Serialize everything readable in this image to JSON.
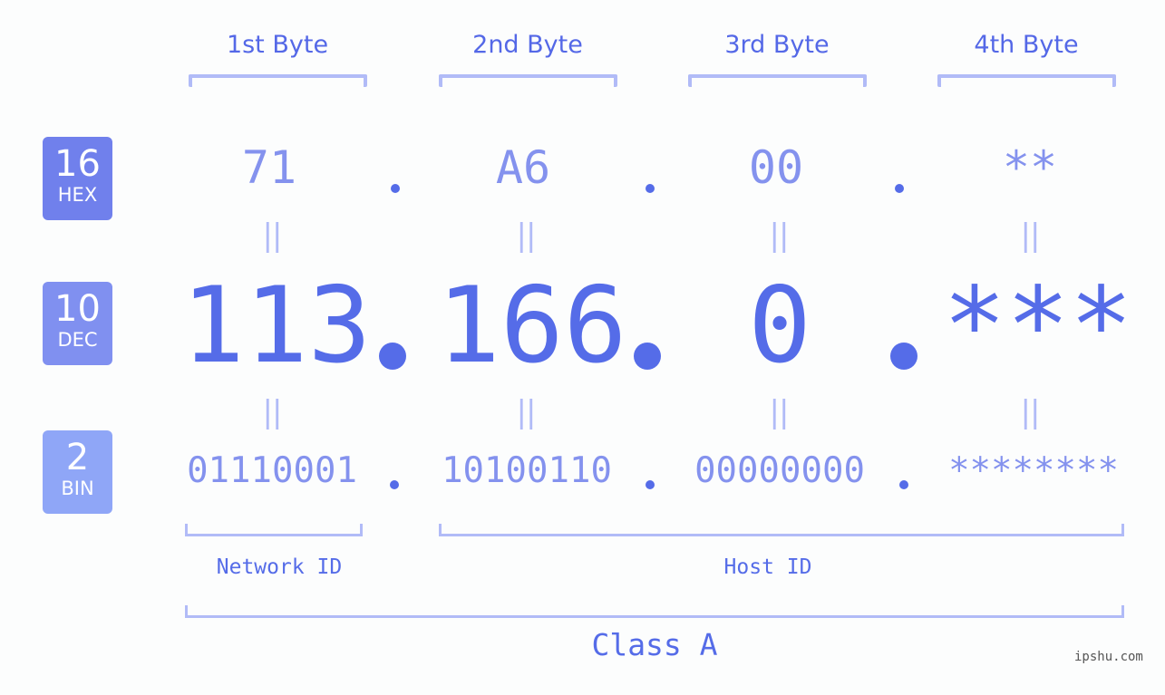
{
  "bytes": [
    {
      "header": "1st Byte",
      "hex": "71",
      "dec": "113",
      "bin": "01110001"
    },
    {
      "header": "2nd Byte",
      "hex": "A6",
      "dec": "166",
      "bin": "10100110"
    },
    {
      "header": "3rd Byte",
      "hex": "00",
      "dec": "0",
      "bin": "00000000"
    },
    {
      "header": "4th Byte",
      "hex": "**",
      "dec": "***",
      "bin": "********"
    }
  ],
  "badges": {
    "hex": {
      "num": "16",
      "label": "HEX",
      "color": "#7080ec"
    },
    "dec": {
      "num": "10",
      "label": "DEC",
      "color": "#8090f0"
    },
    "bin": {
      "num": "2",
      "label": "BIN",
      "color": "#8fa6f7"
    }
  },
  "equals_sign": "||",
  "network_id_label": "Network ID",
  "host_id_label": "Host ID",
  "class_label": "Class A",
  "watermark": "ipshu.com",
  "colors": {
    "primary": "#556ce8",
    "secondary": "#8492ee",
    "bracket": "#b1bbf7"
  }
}
